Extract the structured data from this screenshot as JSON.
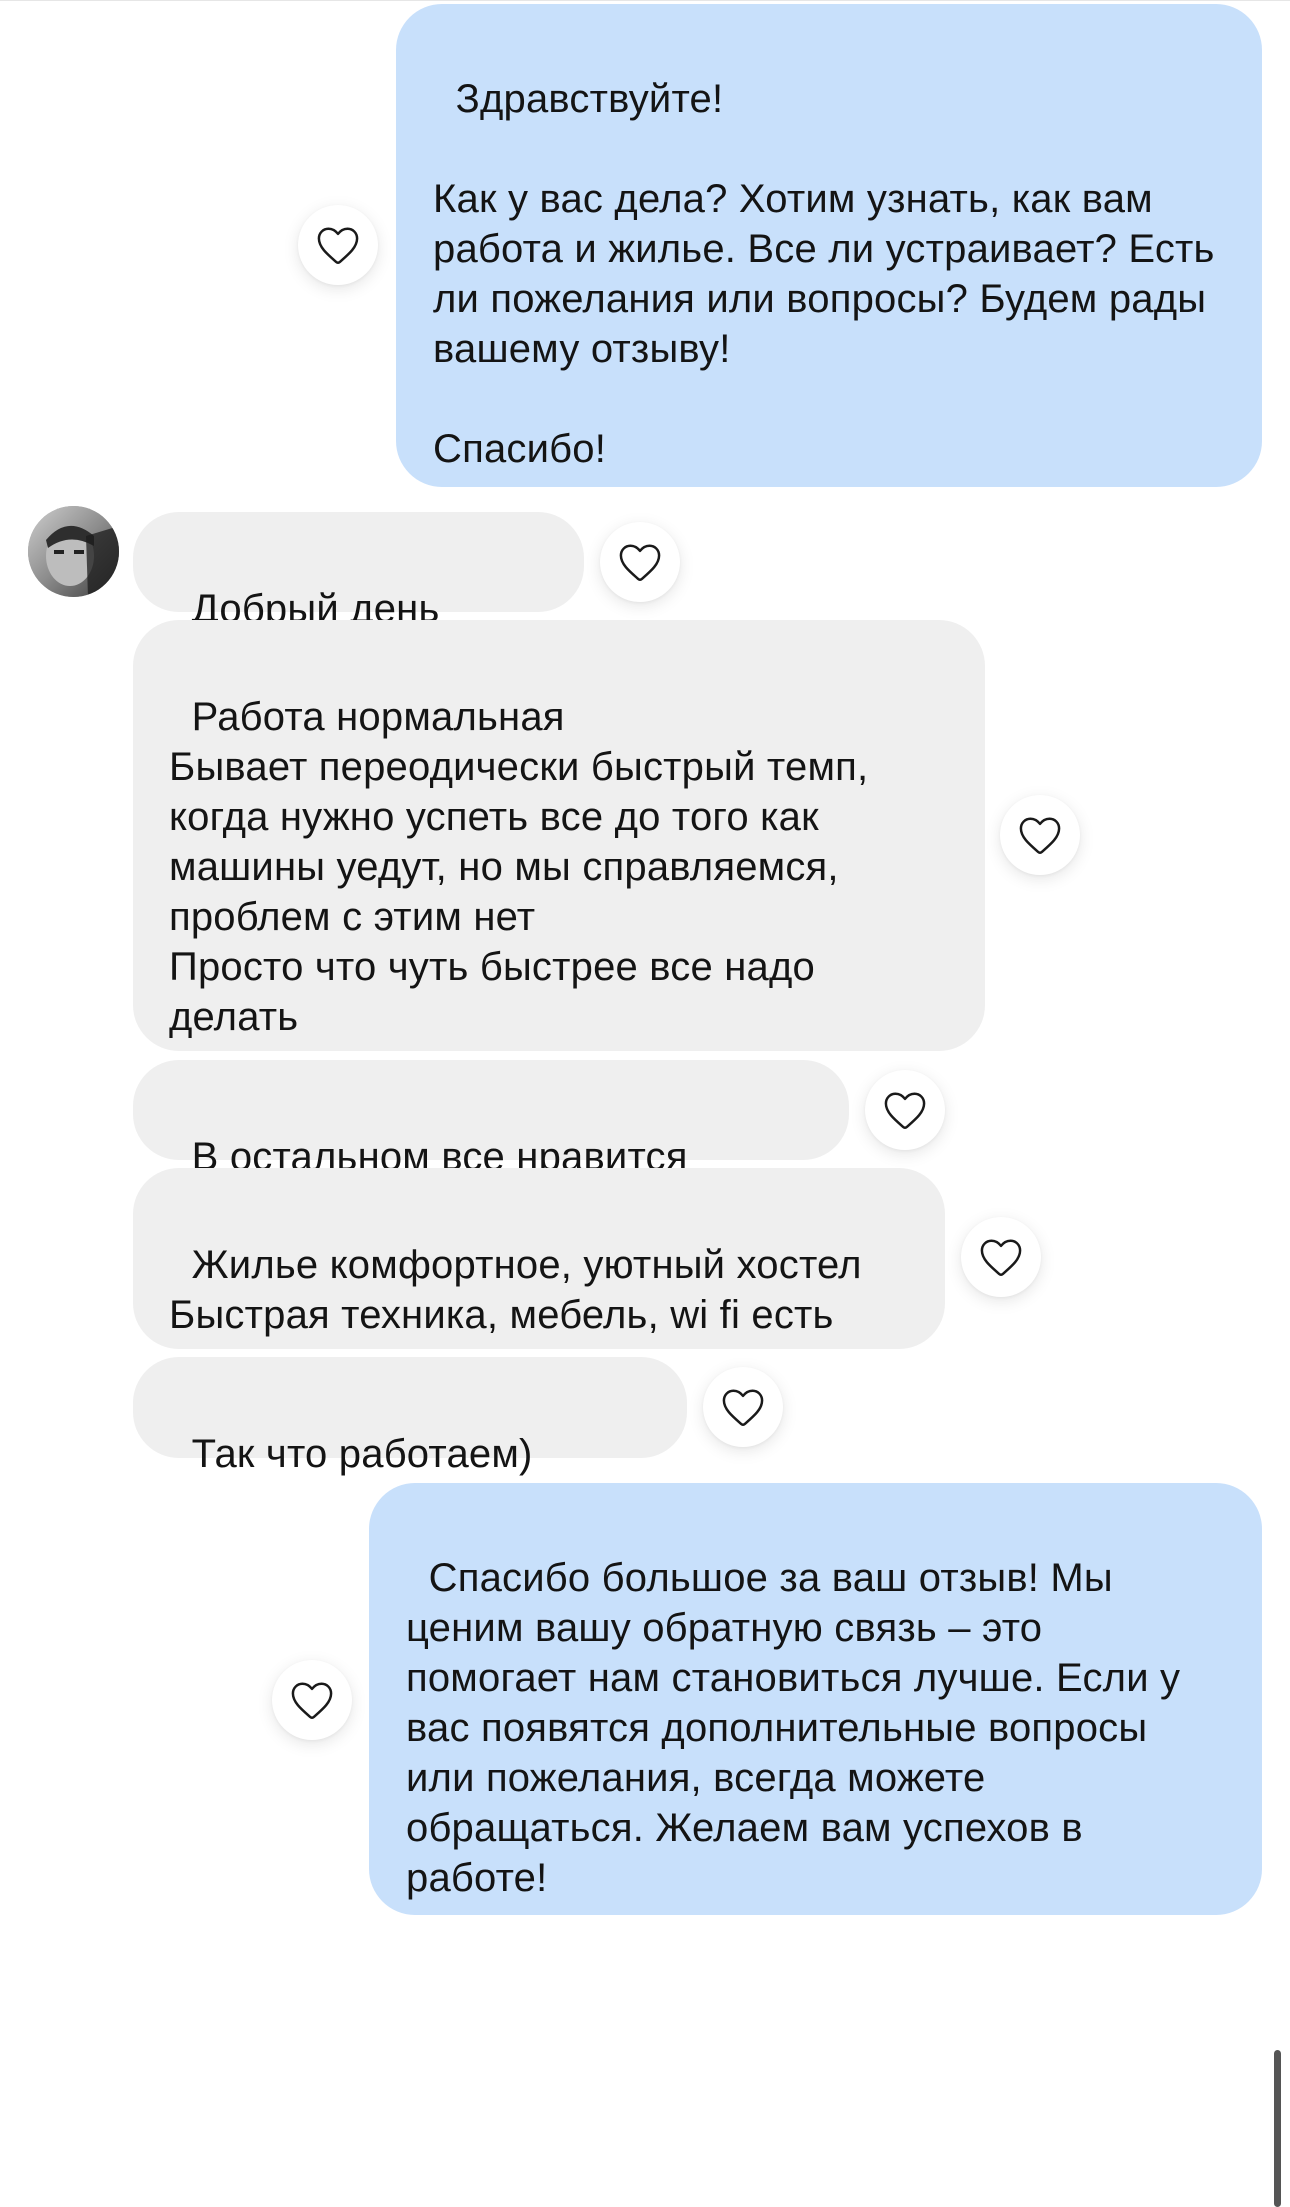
{
  "chat": {
    "messages": [
      {
        "direction": "outgoing",
        "text": "Здравствуйте!\n\nКак у вас дела? Хотим узнать, как вам работа и жилье. Все ли устраивает? Есть ли пожелания или вопросы? Будем рады вашему отзыву!\n\nСпасибо!"
      },
      {
        "direction": "incoming",
        "text": "Добрый день"
      },
      {
        "direction": "incoming",
        "text": "Работа нормальная\nБывает переодически быстрый темп, когда нужно успеть все до того как машины уедут, но мы справляемся, проблем с этим нет\nПросто что чуть быстрее все надо делать"
      },
      {
        "direction": "incoming",
        "text": "В остальном все нравится"
      },
      {
        "direction": "incoming",
        "text": "Жилье комфортное, уютный хостел\nБыстрая техника, мебель, wi fi есть"
      },
      {
        "direction": "incoming",
        "text": "Так что работаем)"
      },
      {
        "direction": "outgoing",
        "text": "Спасибо большое за ваш отзыв! Мы ценим вашу обратную связь – это помогает нам становиться лучше. Если у вас появятся дополнительные вопросы или пожелания, всегда можете обращаться. Желаем вам успехов в работе!"
      }
    ]
  },
  "icons": {
    "like": "heart-outline-icon",
    "avatar": "contact-avatar"
  },
  "colors": {
    "outgoing_bubble": "#c8e0fb",
    "incoming_bubble": "#efefef",
    "text": "#141414",
    "background": "#ffffff"
  }
}
